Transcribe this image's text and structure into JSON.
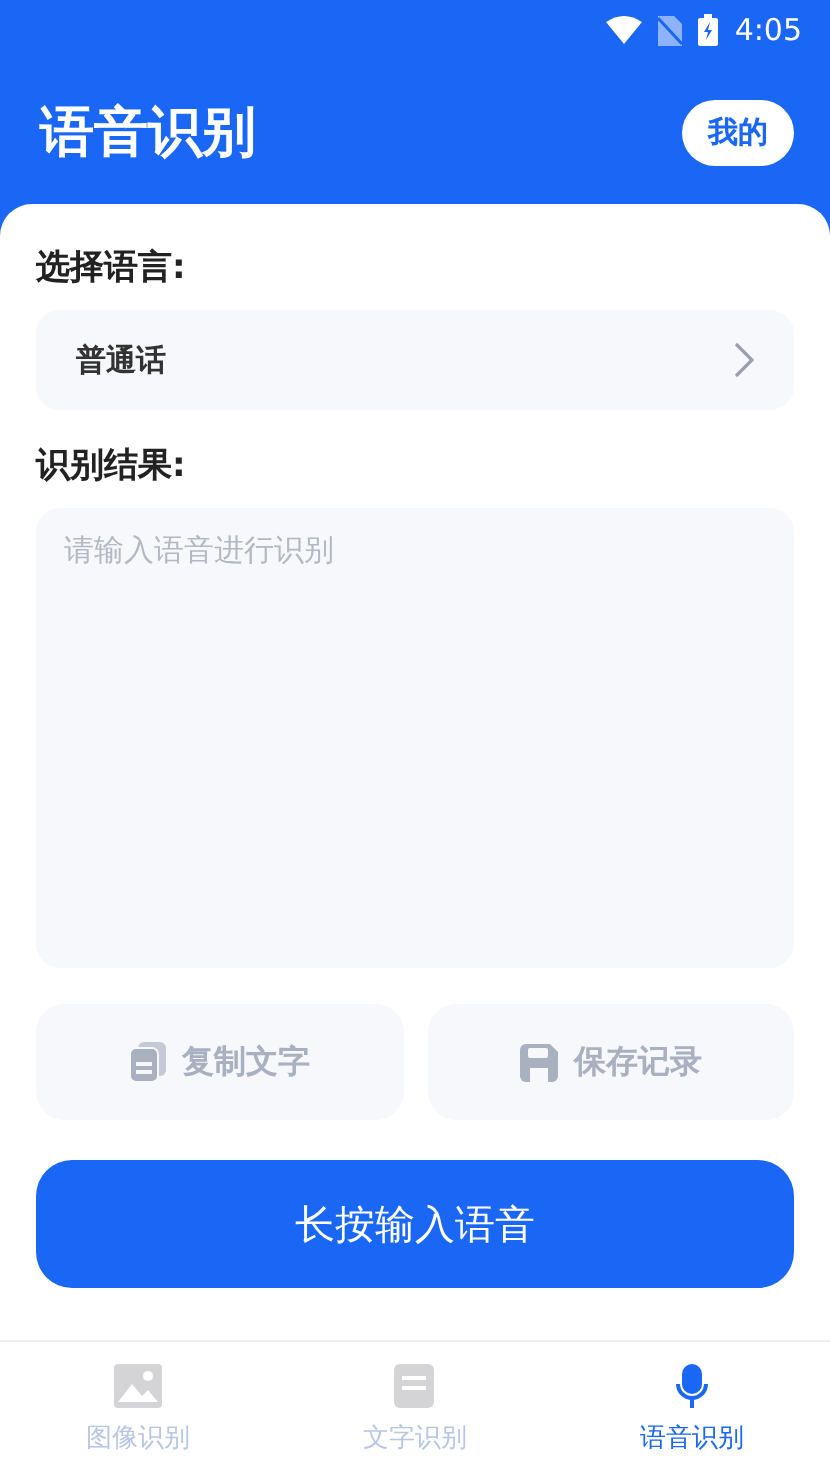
{
  "status_bar": {
    "time": "4:05"
  },
  "header": {
    "title": "语音识别",
    "profile_button": "我的"
  },
  "language": {
    "label": "选择语言:",
    "value": "普通话"
  },
  "result": {
    "label": "识别结果:",
    "placeholder": "请输入语音进行识别"
  },
  "actions": [
    {
      "kind": "copy",
      "label": "复制文字"
    },
    {
      "kind": "save",
      "label": "保存记录"
    }
  ],
  "record_button": "长按输入语音",
  "tabs": [
    {
      "kind": "image",
      "label": "图像识别",
      "selected": false
    },
    {
      "kind": "text",
      "label": "文字识别",
      "selected": false
    },
    {
      "kind": "voice",
      "label": "语音识别",
      "selected": true
    }
  ]
}
